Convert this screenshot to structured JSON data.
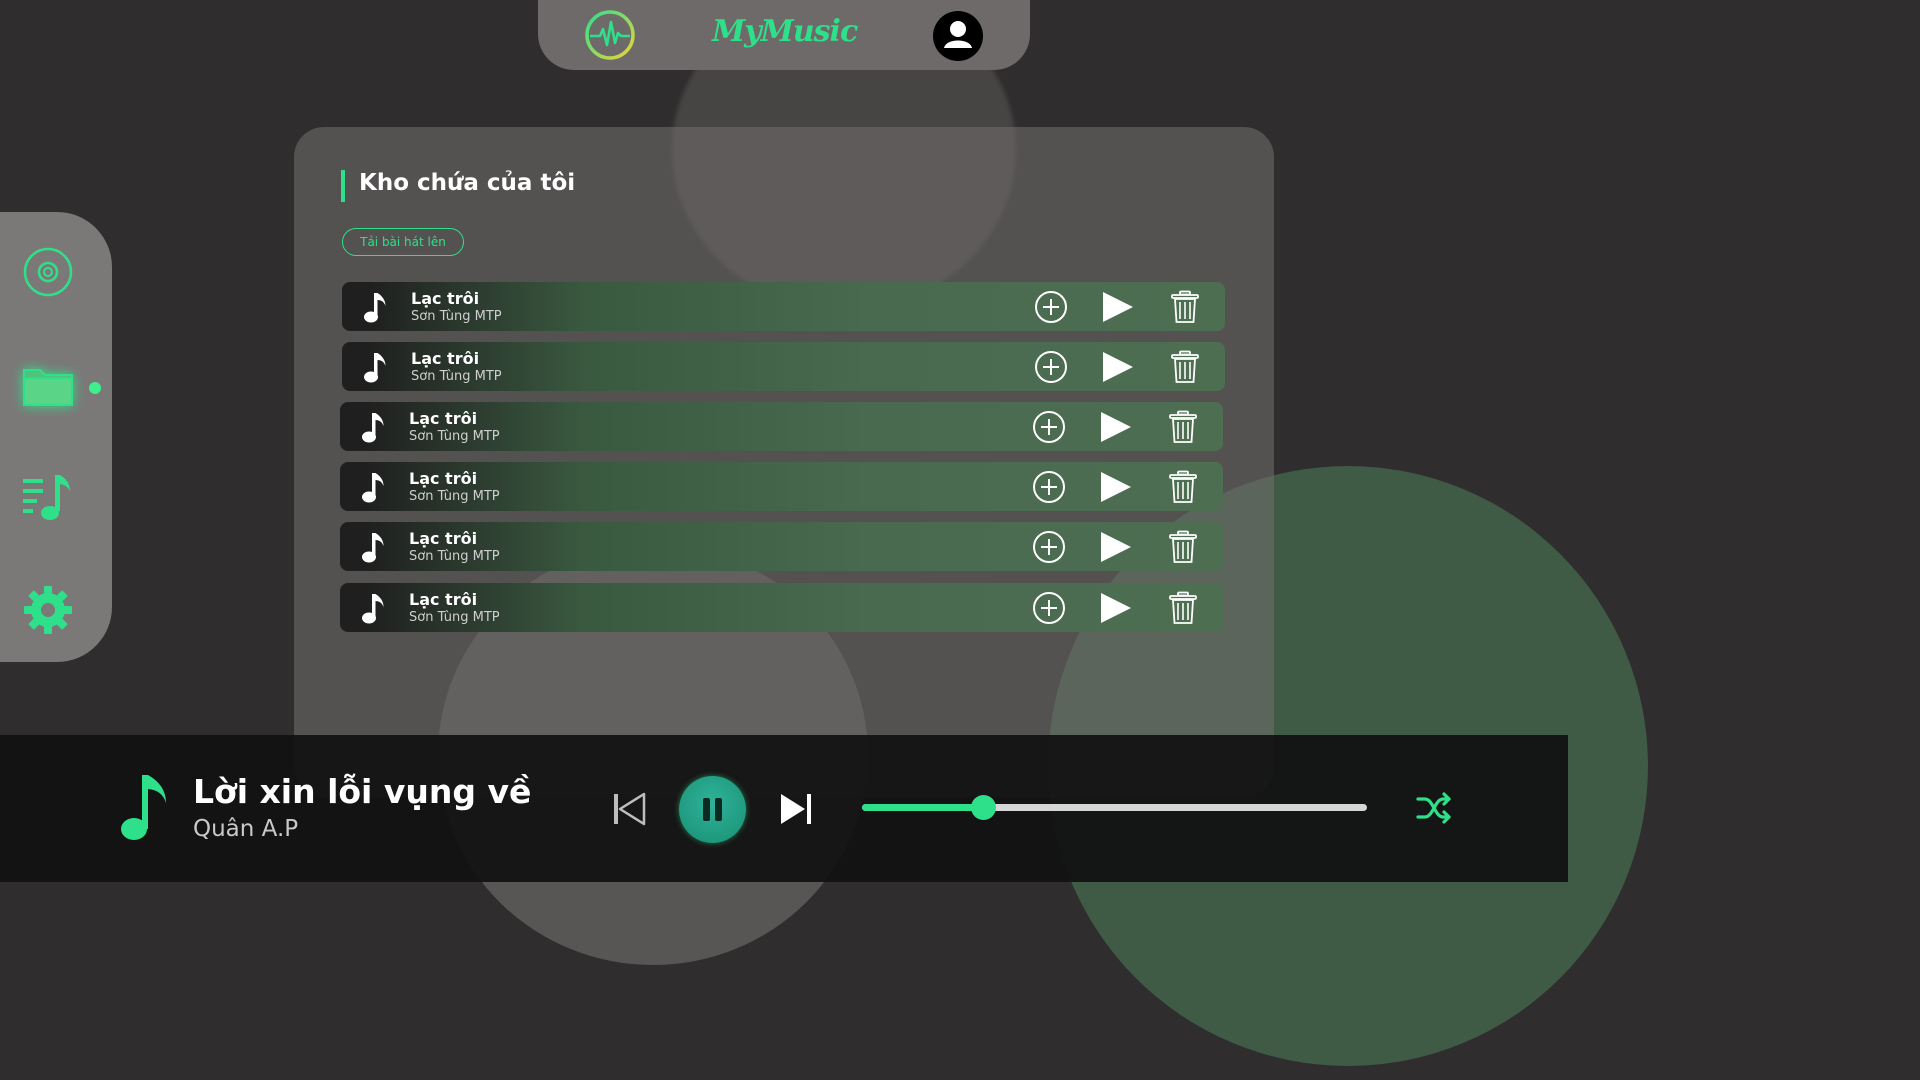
{
  "app": {
    "brand": "MyMusic",
    "accent_color": "#2fe08a"
  },
  "topbar": {
    "logo_icon": "pulse-wave-icon",
    "profile_icon": "user-avatar-icon"
  },
  "sidebar": {
    "items": [
      {
        "name": "disc",
        "icon": "disc-icon",
        "active": false
      },
      {
        "name": "library",
        "icon": "folder-icon",
        "active": true
      },
      {
        "name": "playlist",
        "icon": "playlist-music-icon",
        "active": false
      },
      {
        "name": "settings",
        "icon": "gear-icon",
        "active": false
      }
    ]
  },
  "library": {
    "title": "Kho chứa của tôi",
    "upload_label": "Tải bài hát lên",
    "songs": [
      {
        "title": "Lạc trôi",
        "artist": "Sơn Tùng MTP"
      },
      {
        "title": "Lạc trôi",
        "artist": "Sơn Tùng MTP"
      },
      {
        "title": "Lạc trôi",
        "artist": "Sơn Tùng MTP"
      },
      {
        "title": "Lạc trôi",
        "artist": "Sơn Tùng MTP"
      },
      {
        "title": "Lạc trôi",
        "artist": "Sơn Tùng MTP"
      },
      {
        "title": "Lạc trôi",
        "artist": "Sơn Tùng MTP"
      }
    ]
  },
  "player": {
    "title": "Lời xin lỗi vụng về",
    "artist": "Quân A.P",
    "state": "playing",
    "progress": 0.24
  }
}
